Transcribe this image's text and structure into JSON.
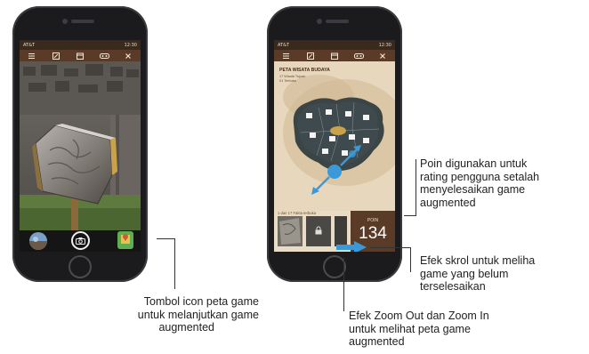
{
  "left_phone": {
    "status_carrier": "AT&T",
    "status_time": "12:30"
  },
  "right_phone": {
    "status_carrier": "AT&T",
    "status_time": "12:30",
    "map_title": "PETA WISATA BUDAYA",
    "map_sub1": "17 Wisata Tujuan",
    "map_sub2": "01 Terbuka",
    "progress_text": "1 dari 17 Fakta terbuka",
    "poin_label": "POIN",
    "poin_value": "134",
    "marker_label": "CANDI LUMBUNG"
  },
  "annotations": {
    "left_tombol": [
      "Tombol icon peta game",
      "untuk melanjutkan game",
      "augmented"
    ],
    "poin": [
      "Poin digunakan untuk",
      "rating pengguna setalah",
      "menyelesaikan game",
      "augmented"
    ],
    "skrol": [
      "Efek skrol untuk meliha",
      "game yang belum",
      "terselesaikan"
    ],
    "zoom": [
      "Efek Zoom Out dan Zoom In",
      "untuk melihat peta game",
      "augmented"
    ]
  },
  "colors": {
    "toolbar": "#5a3b28",
    "accent_blue": "#3a9ad9",
    "poin_box": "#5a3b28",
    "map_bg": "#e9dcc6"
  }
}
